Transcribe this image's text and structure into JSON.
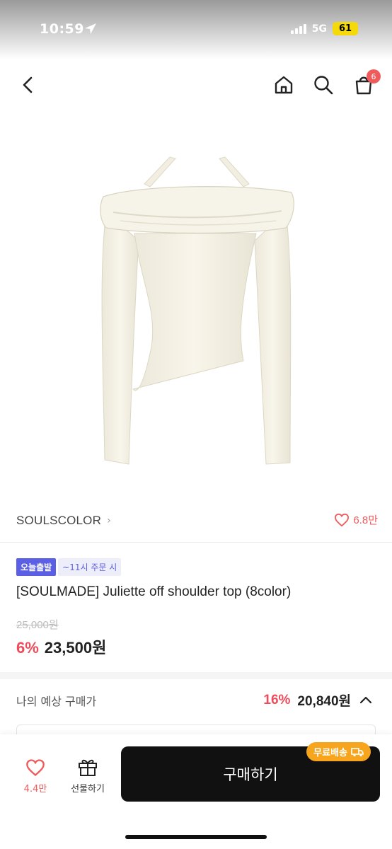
{
  "status_bar": {
    "time": "10:59",
    "network": "5G",
    "battery": "61"
  },
  "nav": {
    "cart_count": "6"
  },
  "product": {
    "brand": "SOULSCOLOR",
    "likes": "6.8만",
    "tags": [
      "오늘출발",
      "~11시 주문 시"
    ],
    "title": "[SOULMADE] Juliette off shoulder top (8color)",
    "original_price": "25,000원",
    "discount": "6%",
    "sale_price": "23,500원"
  },
  "expected": {
    "label": "나의 예상 구매가",
    "discount": "16%",
    "price": "20,840원"
  },
  "bottom_bar": {
    "like_count": "4.4만",
    "gift_label": "선물하기",
    "buy_label": "구매하기",
    "shipping_badge": "무료배송"
  },
  "colors": {
    "accent": "#ef4b5b",
    "tag_blue": "#5b5fe5",
    "shipping": "#f7a51c",
    "button": "#111111"
  }
}
